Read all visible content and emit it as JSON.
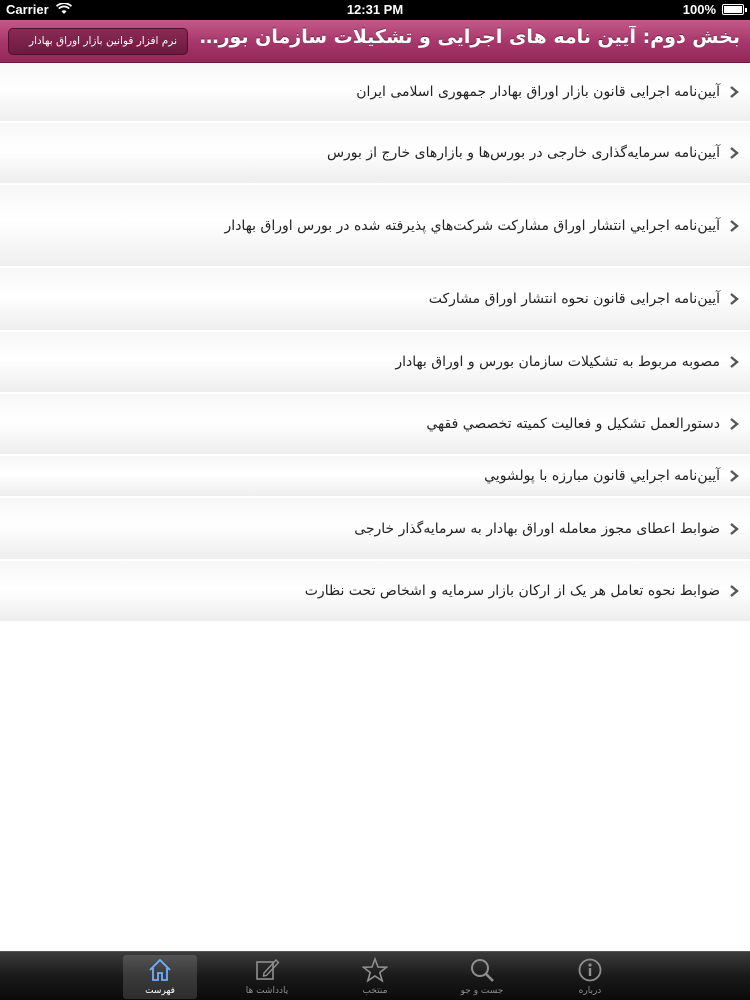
{
  "status_bar": {
    "carrier": "Carrier",
    "time": "12:31 PM",
    "battery": "100%",
    "battery_level": 1.0
  },
  "navbar": {
    "title": "بخش دوم: آیین نامه های اجرایی و تشکیلات سازمان بورس و اورا...",
    "back_label": "نرم افزار قوانین بازار اوراق بهادار",
    "color": "#a9386c"
  },
  "list": {
    "items": [
      {
        "label": "آیین‌نامه اجرایی قانون بازار اوراق بهادار جمهوری اسلامی ایران",
        "icon": "chevron-right-icon"
      },
      {
        "label": "آیین‌نامه سرمایه‌گذاری خارجی در بورس‌ها و بازارهای خارج از بورس",
        "icon": "chevron-right-icon"
      },
      {
        "label": "آيين‌نامه اجرايي انتشار اوراق مشاركت شركت‌هاي پذيرفته شده در بورس اوراق بهادار",
        "icon": "chevron-right-icon"
      },
      {
        "label": "آیین‌نامه اجرایی قانون نحوه انتشار اوراق مشارکت",
        "icon": "chevron-right-icon"
      },
      {
        "label": "مصوبه مربوط به تشکیلات سازمان بورس و اوراق بهادار",
        "icon": "chevron-right-icon"
      },
      {
        "label": "دستورالعمل تشكيل و فعاليت كميته تخصصي فقهي",
        "icon": "chevron-right-icon"
      },
      {
        "label": "آيين‌نامه اجرايي قانون مبارزه با پولشويي",
        "icon": "chevron-right-icon"
      },
      {
        "label": "ضوابط اعطای مجوز معامله اوراق بهادار به سرمایه‌گذار خارجی",
        "icon": "chevron-right-icon"
      },
      {
        "label": "ضوابط نحوه تعامل هر یک از ارکان بازار سرمایه و اشخاص تحت نظارت",
        "icon": "chevron-right-icon"
      }
    ]
  },
  "tabbar": {
    "tabs": [
      {
        "label": "درباره",
        "icon": "info-icon",
        "active": false
      },
      {
        "label": "جست و جو",
        "icon": "search-icon",
        "active": false
      },
      {
        "label": "منتخب",
        "icon": "star-icon",
        "active": false
      },
      {
        "label": "یادداشت ها",
        "icon": "note-edit-icon",
        "active": false
      },
      {
        "label": "فهرست",
        "icon": "home-icon",
        "active": true
      }
    ]
  }
}
